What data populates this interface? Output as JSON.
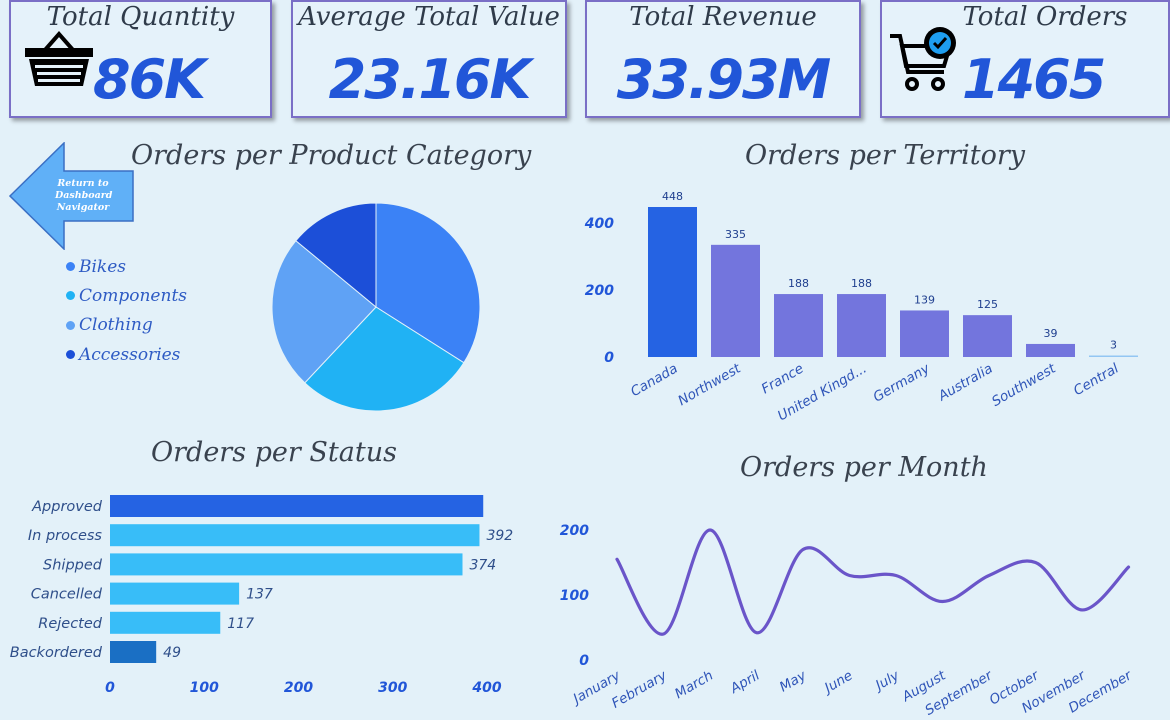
{
  "colors": {
    "background": "#e3f1f9",
    "kpi_value": "#2156d8",
    "accent": "#7a6fc6"
  },
  "kpis": [
    {
      "title": "Total Quantity",
      "value": "86K",
      "icon": "basket-icon"
    },
    {
      "title": "Average Total Value",
      "value": "23.16K"
    },
    {
      "title": "Total Revenue",
      "value": "33.93M"
    },
    {
      "title": "Total Orders",
      "value": "1465",
      "icon": "cart-check-icon"
    }
  ],
  "nav_button": {
    "label": "Return to Dashboard Navigator"
  },
  "chart_data": [
    {
      "type": "pie",
      "title": "Orders per Product Category",
      "categories": [
        "Bikes",
        "Components",
        "Clothing",
        "Accessories"
      ],
      "values": [
        34,
        28,
        24,
        14
      ],
      "colors": [
        "#3b82f6",
        "#20b2f4",
        "#5fa2f5",
        "#1c4fd8"
      ],
      "legend": "left"
    },
    {
      "type": "bar",
      "title": "Orders per Territory",
      "categories": [
        "Canada",
        "Northwest",
        "France",
        "United Kingd...",
        "Germany",
        "Australia",
        "Southwest",
        "Central"
      ],
      "values": [
        448,
        335,
        188,
        188,
        139,
        125,
        39,
        3
      ],
      "data_labels": [
        "448",
        "335",
        "188",
        "188",
        "139",
        "125",
        "39",
        "3"
      ],
      "colors": [
        "#2563e3",
        "#7375dd",
        "#7375dd",
        "#7375dd",
        "#7375dd",
        "#7375dd",
        "#7375dd",
        "#93c6f3"
      ],
      "ylim": [
        0,
        500
      ],
      "yticks": [
        0,
        200,
        400
      ],
      "xlabel": "",
      "ylabel": ""
    },
    {
      "type": "bar",
      "orientation": "horizontal",
      "title": "Orders per Status",
      "categories": [
        "Approved",
        "In process",
        "Shipped",
        "Cancelled",
        "Rejected",
        "Backordered"
      ],
      "values": [
        396,
        392,
        374,
        137,
        117,
        49
      ],
      "data_labels": [
        "",
        "392",
        "374",
        "137",
        "117",
        "49"
      ],
      "colors": [
        "#2563e3",
        "#38bdf8",
        "#38bdf8",
        "#38bdf8",
        "#38bdf8",
        "#1a6fc4"
      ],
      "xlim": [
        0,
        400
      ],
      "xticks": [
        0,
        100,
        200,
        300,
        400
      ]
    },
    {
      "type": "line",
      "title": "Orders per Month",
      "categories": [
        "January",
        "February",
        "March",
        "April",
        "May",
        "June",
        "July",
        "August",
        "September",
        "October",
        "November",
        "December"
      ],
      "values": [
        155,
        40,
        200,
        42,
        170,
        130,
        130,
        90,
        130,
        150,
        77,
        143
      ],
      "color": "#6a55c9",
      "ylim": [
        0,
        220
      ],
      "yticks": [
        0,
        100,
        200
      ]
    }
  ]
}
